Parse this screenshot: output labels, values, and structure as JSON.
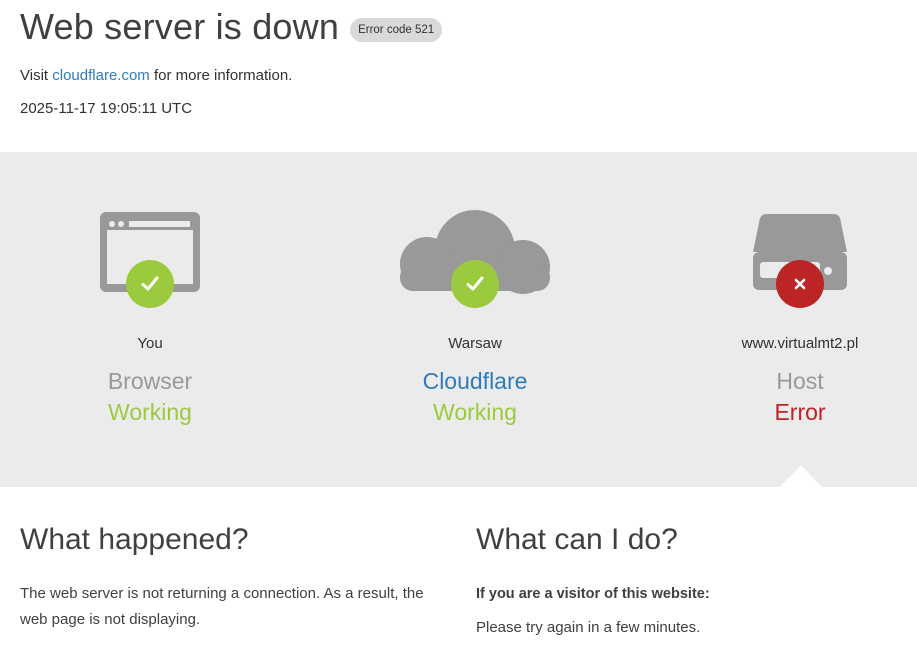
{
  "header": {
    "title": "Web server is down",
    "error_badge": "Error code 521",
    "visit_prefix": "Visit",
    "visit_link": "cloudflare.com",
    "visit_suffix": "for more information.",
    "timestamp": "2025-11-17 19:05:11 UTC"
  },
  "status": [
    {
      "location": "You",
      "entity": "Browser",
      "state": "Working",
      "icon": "browser-icon",
      "ok": true
    },
    {
      "location": "Warsaw",
      "entity": "Cloudflare",
      "state": "Working",
      "icon": "cloud-icon",
      "ok": true
    },
    {
      "location": "www.virtualmt2.pl",
      "entity": "Host",
      "state": "Error",
      "icon": "server-icon",
      "ok": false
    }
  ],
  "what_happened": {
    "heading": "What happened?",
    "body": "The web server is not returning a connection. As a result, the web page is not displaying."
  },
  "what_can_i_do": {
    "heading": "What can I do?",
    "question": "If you are a visitor of this website:",
    "answer": "Please try again in a few minutes."
  },
  "colors": {
    "ok": "#9bca3e",
    "error": "#bd2426",
    "link": "#2f7bbf",
    "band": "#ebebeb",
    "icon_gray": "#999999"
  }
}
